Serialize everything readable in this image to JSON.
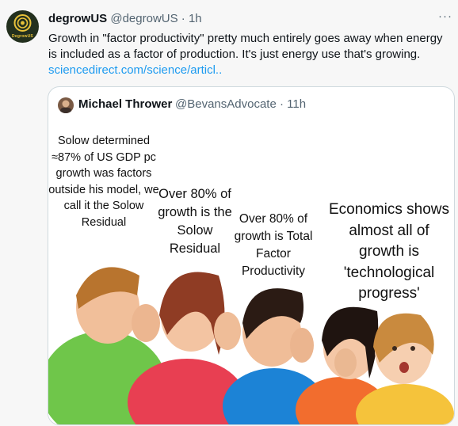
{
  "tweet": {
    "display_name": "degrowUS",
    "handle": "@degrowUS",
    "time": "1h",
    "separator": "·",
    "more_label": "···",
    "avatar_text": "DegrowUS",
    "text": "Growth in \"factor productivity\" pretty much entirely goes away when energy is included as a factor of production. It's just energy use that's growing.",
    "link_text": "sciencedirect.com/science/articl.."
  },
  "quote": {
    "display_name": "Michael Thrower",
    "handle": "@BevansAdvocate",
    "separator": "·",
    "time": "11h"
  },
  "meme": {
    "captions": [
      "Solow determined ≈87% of US GDP pc growth was factors outside his model, we call it the Solow Residual",
      "Over 80% of growth is the Solow Residual",
      "Over 80% of growth is Total Factor Productivity",
      "Economics shows almost all of growth is 'technological progress'"
    ]
  },
  "colors": {
    "link": "#1d9bf0",
    "secondary_text": "#536471",
    "border": "#cfd9de",
    "avatar_bg": "#23301e",
    "avatar_ring": "#e8c23a"
  },
  "icons": {
    "more": "more-horizontal-icon"
  }
}
